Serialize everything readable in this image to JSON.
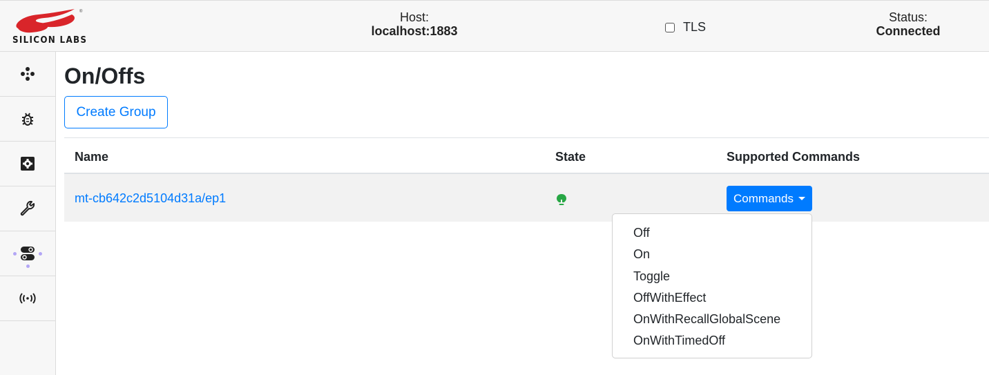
{
  "header": {
    "logo_text": "SILICON LABS",
    "host_label": "Host:",
    "host_value": "localhost:1883",
    "tls_label": "TLS",
    "tls_checked": false,
    "status_label": "Status:",
    "status_value": "Connected"
  },
  "sidebar": {
    "items": [
      {
        "icon": "nodes-icon"
      },
      {
        "icon": "bug-icon"
      },
      {
        "icon": "gear-icon"
      },
      {
        "icon": "wrench-icon"
      },
      {
        "icon": "toggles-icon",
        "active": true
      },
      {
        "icon": "broadcast-icon"
      }
    ]
  },
  "main": {
    "title": "On/Offs",
    "create_group_label": "Create Group",
    "table": {
      "columns": [
        "Name",
        "State",
        "Supported Commands"
      ],
      "rows": [
        {
          "name": "mt-cb642c2d5104d31a/ep1",
          "state": "on",
          "state_icon": "lightbulb-icon",
          "state_color": "#28a745",
          "commands_label": "Commands"
        }
      ]
    },
    "commands_menu": [
      "Off",
      "On",
      "Toggle",
      "OffWithEffect",
      "OnWithRecallGlobalScene",
      "OnWithTimedOff"
    ]
  },
  "colors": {
    "accent": "#007bff",
    "state_on": "#28a745",
    "logo_red": "#d9252a",
    "active_dots": "#b3a6f5"
  }
}
